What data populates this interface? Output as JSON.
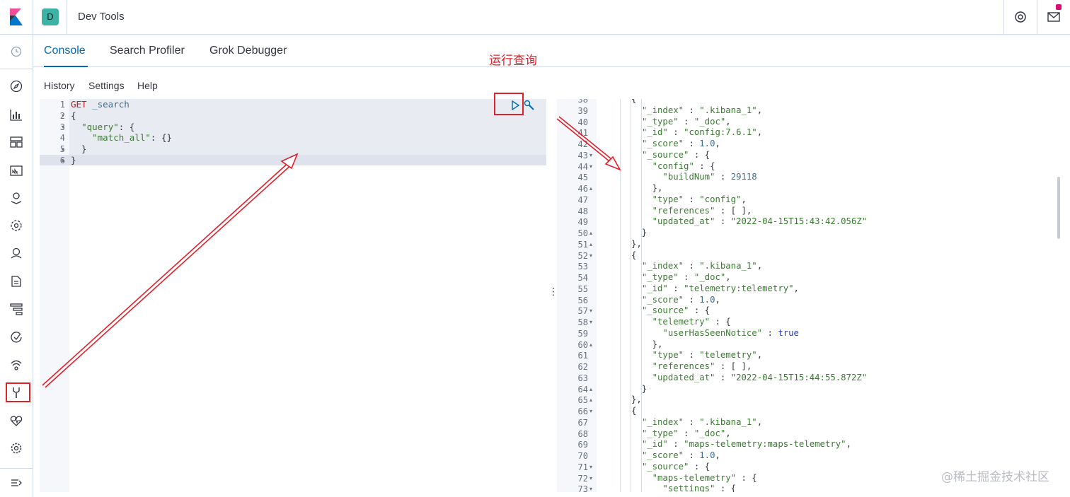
{
  "header": {
    "space_letter": "D",
    "app_title": "Dev Tools"
  },
  "nav_icons": [
    "clock-icon",
    "compass-icon",
    "visualize-icon",
    "dashboard-icon",
    "canvas-icon",
    "maps-icon",
    "ml-icon",
    "infra-icon",
    "logs-icon",
    "apm-icon",
    "uptime-icon",
    "siem-icon",
    "dev-tools-icon",
    "monitoring-icon",
    "settings-icon",
    "dock-icon"
  ],
  "tabs": [
    {
      "label": "Console",
      "active": true
    },
    {
      "label": "Search Profiler",
      "active": false
    },
    {
      "label": "Grok Debugger",
      "active": false
    }
  ],
  "console_menu": [
    "History",
    "Settings",
    "Help"
  ],
  "annotation": "运行查询",
  "editor": {
    "line_numbers": [
      "1",
      "2",
      "3",
      "4",
      "5",
      "6"
    ],
    "lines": [
      [
        {
          "t": "GET",
          "c": "kw-method"
        },
        {
          "t": " _search",
          "c": "kw-path"
        }
      ],
      [
        {
          "t": "{",
          "c": "kw-punc"
        }
      ],
      [
        {
          "t": "  ",
          "c": "kw-punc"
        },
        {
          "t": "\"query\"",
          "c": "kw-key"
        },
        {
          "t": ": {",
          "c": "kw-punc"
        }
      ],
      [
        {
          "t": "    ",
          "c": "kw-punc"
        },
        {
          "t": "\"match_all\"",
          "c": "kw-key"
        },
        {
          "t": ": {}",
          "c": "kw-punc"
        }
      ],
      [
        {
          "t": "  }",
          "c": "kw-punc"
        }
      ],
      [
        {
          "t": "}",
          "c": "kw-punc"
        }
      ]
    ]
  },
  "output": {
    "lines": [
      {
        "n": "38",
        "fold": "",
        "t": [
          {
            "t": "{",
            "c": ""
          }
        ]
      },
      {
        "n": "39",
        "fold": "",
        "t": [
          {
            "t": "  ",
            "c": ""
          },
          {
            "t": "\"_index\"",
            "c": "key"
          },
          {
            "t": " : ",
            "c": ""
          },
          {
            "t": "\".kibana_1\"",
            "c": "str"
          },
          {
            "t": ",",
            "c": ""
          }
        ]
      },
      {
        "n": "40",
        "fold": "",
        "t": [
          {
            "t": "  ",
            "c": ""
          },
          {
            "t": "\"_type\"",
            "c": "key"
          },
          {
            "t": " : ",
            "c": ""
          },
          {
            "t": "\"_doc\"",
            "c": "str"
          },
          {
            "t": ",",
            "c": ""
          }
        ]
      },
      {
        "n": "41",
        "fold": "",
        "t": [
          {
            "t": "  ",
            "c": ""
          },
          {
            "t": "\"_id\"",
            "c": "key"
          },
          {
            "t": " : ",
            "c": ""
          },
          {
            "t": "\"config:7.6.1\"",
            "c": "str"
          },
          {
            "t": ",",
            "c": ""
          }
        ]
      },
      {
        "n": "42",
        "fold": "",
        "t": [
          {
            "t": "  ",
            "c": ""
          },
          {
            "t": "\"_score\"",
            "c": "key"
          },
          {
            "t": " : ",
            "c": ""
          },
          {
            "t": "1.0",
            "c": "num"
          },
          {
            "t": ",",
            "c": ""
          }
        ]
      },
      {
        "n": "43",
        "fold": "▾",
        "t": [
          {
            "t": "  ",
            "c": ""
          },
          {
            "t": "\"_source\"",
            "c": "key"
          },
          {
            "t": " : {",
            "c": ""
          }
        ]
      },
      {
        "n": "44",
        "fold": "▾",
        "t": [
          {
            "t": "    ",
            "c": ""
          },
          {
            "t": "\"config\"",
            "c": "key"
          },
          {
            "t": " : {",
            "c": ""
          }
        ]
      },
      {
        "n": "45",
        "fold": "",
        "t": [
          {
            "t": "      ",
            "c": ""
          },
          {
            "t": "\"buildNum\"",
            "c": "key"
          },
          {
            "t": " : ",
            "c": ""
          },
          {
            "t": "29118",
            "c": "num"
          }
        ]
      },
      {
        "n": "46",
        "fold": "▴",
        "t": [
          {
            "t": "    },",
            "c": ""
          }
        ]
      },
      {
        "n": "47",
        "fold": "",
        "t": [
          {
            "t": "    ",
            "c": ""
          },
          {
            "t": "\"type\"",
            "c": "key"
          },
          {
            "t": " : ",
            "c": ""
          },
          {
            "t": "\"config\"",
            "c": "str"
          },
          {
            "t": ",",
            "c": ""
          }
        ]
      },
      {
        "n": "48",
        "fold": "",
        "t": [
          {
            "t": "    ",
            "c": ""
          },
          {
            "t": "\"references\"",
            "c": "key"
          },
          {
            "t": " : [ ],",
            "c": ""
          }
        ]
      },
      {
        "n": "49",
        "fold": "",
        "t": [
          {
            "t": "    ",
            "c": ""
          },
          {
            "t": "\"updated_at\"",
            "c": "key"
          },
          {
            "t": " : ",
            "c": ""
          },
          {
            "t": "\"2022-04-15T15:43:42.056Z\"",
            "c": "str"
          }
        ]
      },
      {
        "n": "50",
        "fold": "▴",
        "t": [
          {
            "t": "  }",
            "c": ""
          }
        ]
      },
      {
        "n": "51",
        "fold": "▴",
        "t": [
          {
            "t": "},",
            "c": ""
          }
        ]
      },
      {
        "n": "52",
        "fold": "▾",
        "t": [
          {
            "t": "{",
            "c": ""
          }
        ]
      },
      {
        "n": "53",
        "fold": "",
        "t": [
          {
            "t": "  ",
            "c": ""
          },
          {
            "t": "\"_index\"",
            "c": "key"
          },
          {
            "t": " : ",
            "c": ""
          },
          {
            "t": "\".kibana_1\"",
            "c": "str"
          },
          {
            "t": ",",
            "c": ""
          }
        ]
      },
      {
        "n": "54",
        "fold": "",
        "t": [
          {
            "t": "  ",
            "c": ""
          },
          {
            "t": "\"_type\"",
            "c": "key"
          },
          {
            "t": " : ",
            "c": ""
          },
          {
            "t": "\"_doc\"",
            "c": "str"
          },
          {
            "t": ",",
            "c": ""
          }
        ]
      },
      {
        "n": "55",
        "fold": "",
        "t": [
          {
            "t": "  ",
            "c": ""
          },
          {
            "t": "\"_id\"",
            "c": "key"
          },
          {
            "t": " : ",
            "c": ""
          },
          {
            "t": "\"telemetry:telemetry\"",
            "c": "str"
          },
          {
            "t": ",",
            "c": ""
          }
        ]
      },
      {
        "n": "56",
        "fold": "",
        "t": [
          {
            "t": "  ",
            "c": ""
          },
          {
            "t": "\"_score\"",
            "c": "key"
          },
          {
            "t": " : ",
            "c": ""
          },
          {
            "t": "1.0",
            "c": "num"
          },
          {
            "t": ",",
            "c": ""
          }
        ]
      },
      {
        "n": "57",
        "fold": "▾",
        "t": [
          {
            "t": "  ",
            "c": ""
          },
          {
            "t": "\"_source\"",
            "c": "key"
          },
          {
            "t": " : {",
            "c": ""
          }
        ]
      },
      {
        "n": "58",
        "fold": "▾",
        "t": [
          {
            "t": "    ",
            "c": ""
          },
          {
            "t": "\"telemetry\"",
            "c": "key"
          },
          {
            "t": " : {",
            "c": ""
          }
        ]
      },
      {
        "n": "59",
        "fold": "",
        "t": [
          {
            "t": "      ",
            "c": ""
          },
          {
            "t": "\"userHasSeenNotice\"",
            "c": "key"
          },
          {
            "t": " : ",
            "c": ""
          },
          {
            "t": "true",
            "c": "bool"
          }
        ]
      },
      {
        "n": "60",
        "fold": "▴",
        "t": [
          {
            "t": "    },",
            "c": ""
          }
        ]
      },
      {
        "n": "61",
        "fold": "",
        "t": [
          {
            "t": "    ",
            "c": ""
          },
          {
            "t": "\"type\"",
            "c": "key"
          },
          {
            "t": " : ",
            "c": ""
          },
          {
            "t": "\"telemetry\"",
            "c": "str"
          },
          {
            "t": ",",
            "c": ""
          }
        ]
      },
      {
        "n": "62",
        "fold": "",
        "t": [
          {
            "t": "    ",
            "c": ""
          },
          {
            "t": "\"references\"",
            "c": "key"
          },
          {
            "t": " : [ ],",
            "c": ""
          }
        ]
      },
      {
        "n": "63",
        "fold": "",
        "t": [
          {
            "t": "    ",
            "c": ""
          },
          {
            "t": "\"updated_at\"",
            "c": "key"
          },
          {
            "t": " : ",
            "c": ""
          },
          {
            "t": "\"2022-04-15T15:44:55.872Z\"",
            "c": "str"
          }
        ]
      },
      {
        "n": "64",
        "fold": "▴",
        "t": [
          {
            "t": "  }",
            "c": ""
          }
        ]
      },
      {
        "n": "65",
        "fold": "▴",
        "t": [
          {
            "t": "},",
            "c": ""
          }
        ]
      },
      {
        "n": "66",
        "fold": "▾",
        "t": [
          {
            "t": "{",
            "c": ""
          }
        ]
      },
      {
        "n": "67",
        "fold": "",
        "t": [
          {
            "t": "  ",
            "c": ""
          },
          {
            "t": "\"_index\"",
            "c": "key"
          },
          {
            "t": " : ",
            "c": ""
          },
          {
            "t": "\".kibana_1\"",
            "c": "str"
          },
          {
            "t": ",",
            "c": ""
          }
        ]
      },
      {
        "n": "68",
        "fold": "",
        "t": [
          {
            "t": "  ",
            "c": ""
          },
          {
            "t": "\"_type\"",
            "c": "key"
          },
          {
            "t": " : ",
            "c": ""
          },
          {
            "t": "\"_doc\"",
            "c": "str"
          },
          {
            "t": ",",
            "c": ""
          }
        ]
      },
      {
        "n": "69",
        "fold": "",
        "t": [
          {
            "t": "  ",
            "c": ""
          },
          {
            "t": "\"_id\"",
            "c": "key"
          },
          {
            "t": " : ",
            "c": ""
          },
          {
            "t": "\"maps-telemetry:maps-telemetry\"",
            "c": "str"
          },
          {
            "t": ",",
            "c": ""
          }
        ]
      },
      {
        "n": "70",
        "fold": "",
        "t": [
          {
            "t": "  ",
            "c": ""
          },
          {
            "t": "\"_score\"",
            "c": "key"
          },
          {
            "t": " : ",
            "c": ""
          },
          {
            "t": "1.0",
            "c": "num"
          },
          {
            "t": ",",
            "c": ""
          }
        ]
      },
      {
        "n": "71",
        "fold": "▾",
        "t": [
          {
            "t": "  ",
            "c": ""
          },
          {
            "t": "\"_source\"",
            "c": "key"
          },
          {
            "t": " : {",
            "c": ""
          }
        ]
      },
      {
        "n": "72",
        "fold": "▾",
        "t": [
          {
            "t": "    ",
            "c": ""
          },
          {
            "t": "\"maps-telemetry\"",
            "c": "key"
          },
          {
            "t": " : {",
            "c": ""
          }
        ]
      },
      {
        "n": "73",
        "fold": "▾",
        "t": [
          {
            "t": "      ",
            "c": ""
          },
          {
            "t": "\"settings\"",
            "c": "key"
          },
          {
            "t": " : {",
            "c": ""
          }
        ]
      }
    ]
  },
  "watermark": "@稀土掘金技术社区",
  "colors": {
    "accent": "#006bb4",
    "annotation": "#e0202a",
    "space_badge": "#3eb3a5",
    "notification": "#dd0a73"
  }
}
